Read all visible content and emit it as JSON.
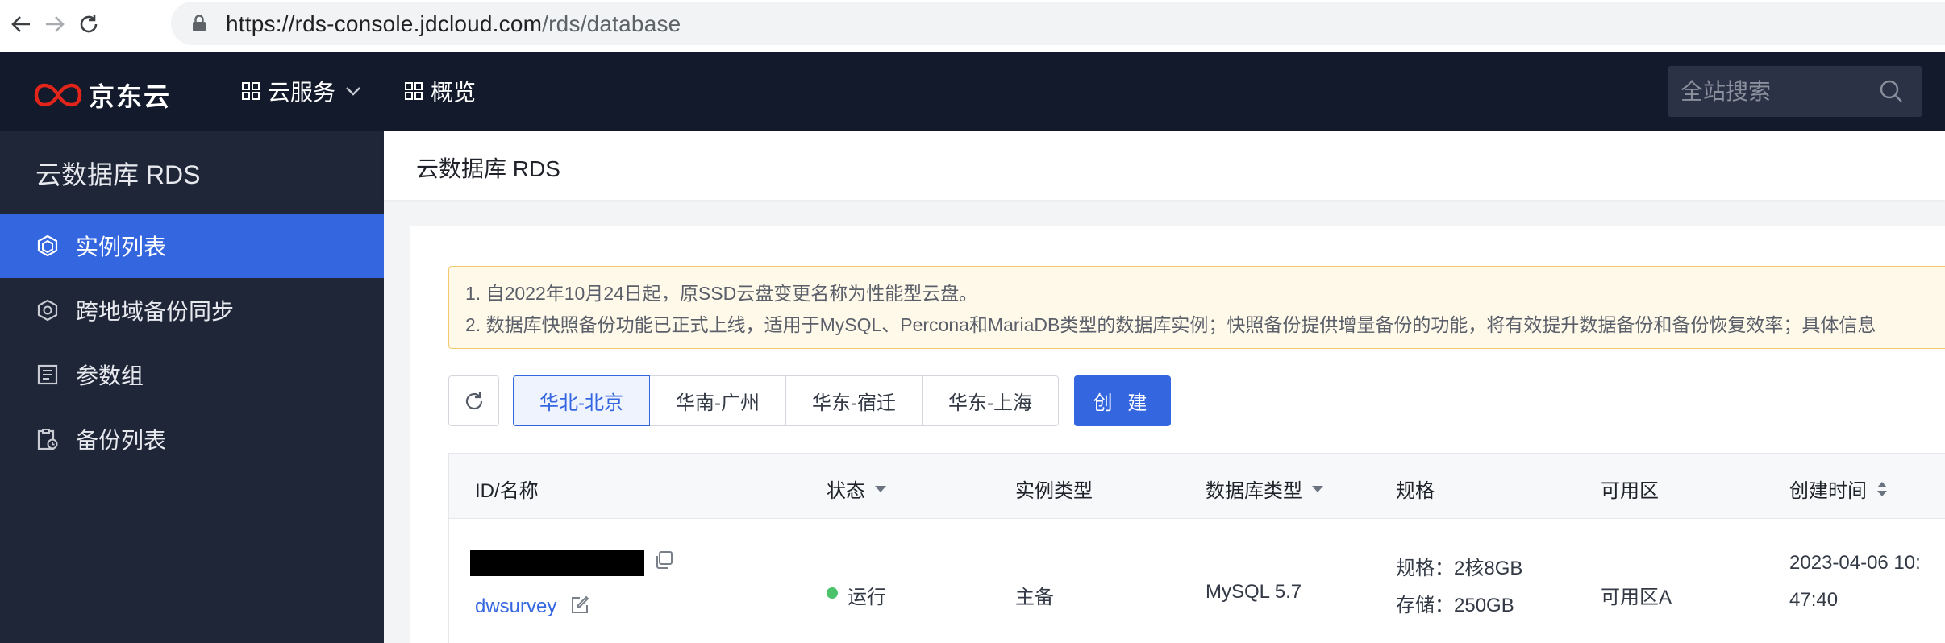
{
  "browser": {
    "url_host": "https://rds-console.jdcloud.com",
    "url_path": "/rds/database"
  },
  "topbar": {
    "logo_text": "京东云",
    "menu": [
      {
        "label": "云服务"
      },
      {
        "label": "概览"
      }
    ],
    "search_placeholder": "全站搜索"
  },
  "sidebar": {
    "title": "云数据库 RDS",
    "items": [
      {
        "label": "实例列表",
        "active": true
      },
      {
        "label": "跨地域备份同步"
      },
      {
        "label": "参数组"
      },
      {
        "label": "备份列表"
      }
    ]
  },
  "page": {
    "title": "云数据库 RDS"
  },
  "notice": {
    "lines": [
      "1. 自2022年10月24日起，原SSD云盘变更名称为性能型云盘。",
      "2. 数据库快照备份功能已正式上线，适用于MySQL、Percona和MariaDB类型的数据库实例；快照备份提供增量备份的功能，将有效提升数据备份和备份恢复效率；具体信息"
    ]
  },
  "regions": {
    "tabs": [
      "华北-北京",
      "华南-广州",
      "华东-宿迁",
      "华东-上海"
    ],
    "active": "华北-北京"
  },
  "create_label": "创 建",
  "table": {
    "headers": [
      "ID/名称",
      "状态",
      "实例类型",
      "数据库类型",
      "规格",
      "可用区",
      "创建时间"
    ],
    "rows": [
      {
        "name": "dwsurvey",
        "status": "运行",
        "instance_type": "主备",
        "db_type": "MySQL 5.7",
        "spec_line1": "规格：2核8GB",
        "spec_line2": "存储：250GB",
        "zone": "可用区A",
        "created_line1": "2023-04-06 10:",
        "created_line2": "47:40"
      }
    ]
  },
  "colors": {
    "accent": "#3466e0",
    "topbar_bg": "#131a2b",
    "sidebar_bg": "#1f2638",
    "status_running": "#4cc36a"
  }
}
